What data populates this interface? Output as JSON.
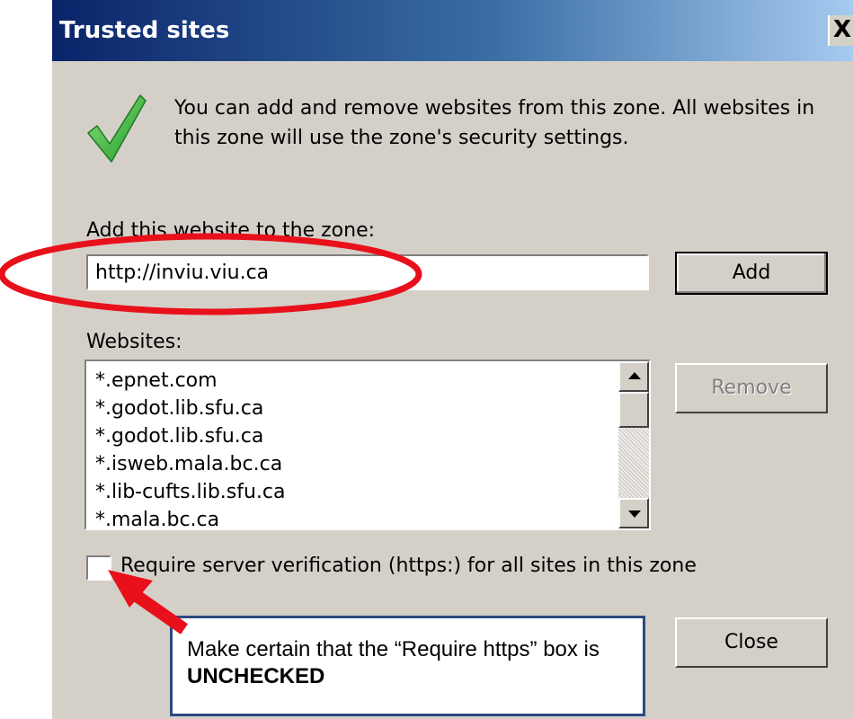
{
  "window": {
    "title": "Trusted sites",
    "close_glyph": "X"
  },
  "intro_text": "You can add and remove websites from this zone. All websites in this zone will use the zone's security settings.",
  "add_section": {
    "label": "Add this website to the zone:",
    "url_value": "http://inviu.viu.ca",
    "add_button": "Add"
  },
  "websites": {
    "label": "Websites:",
    "items": [
      "*.epnet.com",
      "*.godot.lib.sfu.ca",
      "*.godot.lib.sfu.ca",
      "*.isweb.mala.bc.ca",
      "*.lib-cufts.lib.sfu.ca",
      "*.mala.bc.ca"
    ],
    "remove_button": "Remove"
  },
  "require_https": {
    "label": "Require server verification (https:) for all sites in this zone",
    "checked": false
  },
  "close_button": "Close",
  "callout": {
    "text_before": "Make certain that the “Require https” box is ",
    "text_bold": "UNCHECKED"
  },
  "icons": {
    "zone_icon": "green-checkmark-icon",
    "scroll_up": "arrow-up-icon",
    "scroll_down": "arrow-down-icon"
  },
  "colors": {
    "title_bar_start": "#0a246a",
    "title_bar_end": "#a6caf0",
    "dialog_face": "#d4d0c8",
    "annotation_red": "#e8101a",
    "callout_border": "#2b4a7e",
    "check_green": "#3fbf3a"
  }
}
